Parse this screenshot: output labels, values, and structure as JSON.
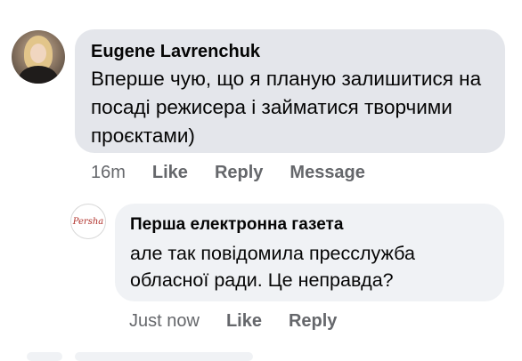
{
  "comment": {
    "author": "Eugene Lavrenchuk",
    "text": "Вперше чую, що я планую залишитися на посаді режисера і займатися творчими проєктами)",
    "time": "16m",
    "actions": [
      "Like",
      "Reply",
      "Message"
    ]
  },
  "reply": {
    "avatar_logo": "Persha",
    "author": "Перша електронна газета",
    "text": "але так повідомила пресслужба обласної ради. Це неправда?",
    "time": "Just now",
    "actions": [
      "Like",
      "Reply"
    ]
  },
  "colors": {
    "bubble_primary": "#e4e6eb",
    "bubble_reply": "#f0f2f5",
    "meta_text": "#65676b",
    "text": "#050505",
    "logo": "#b0302a"
  }
}
